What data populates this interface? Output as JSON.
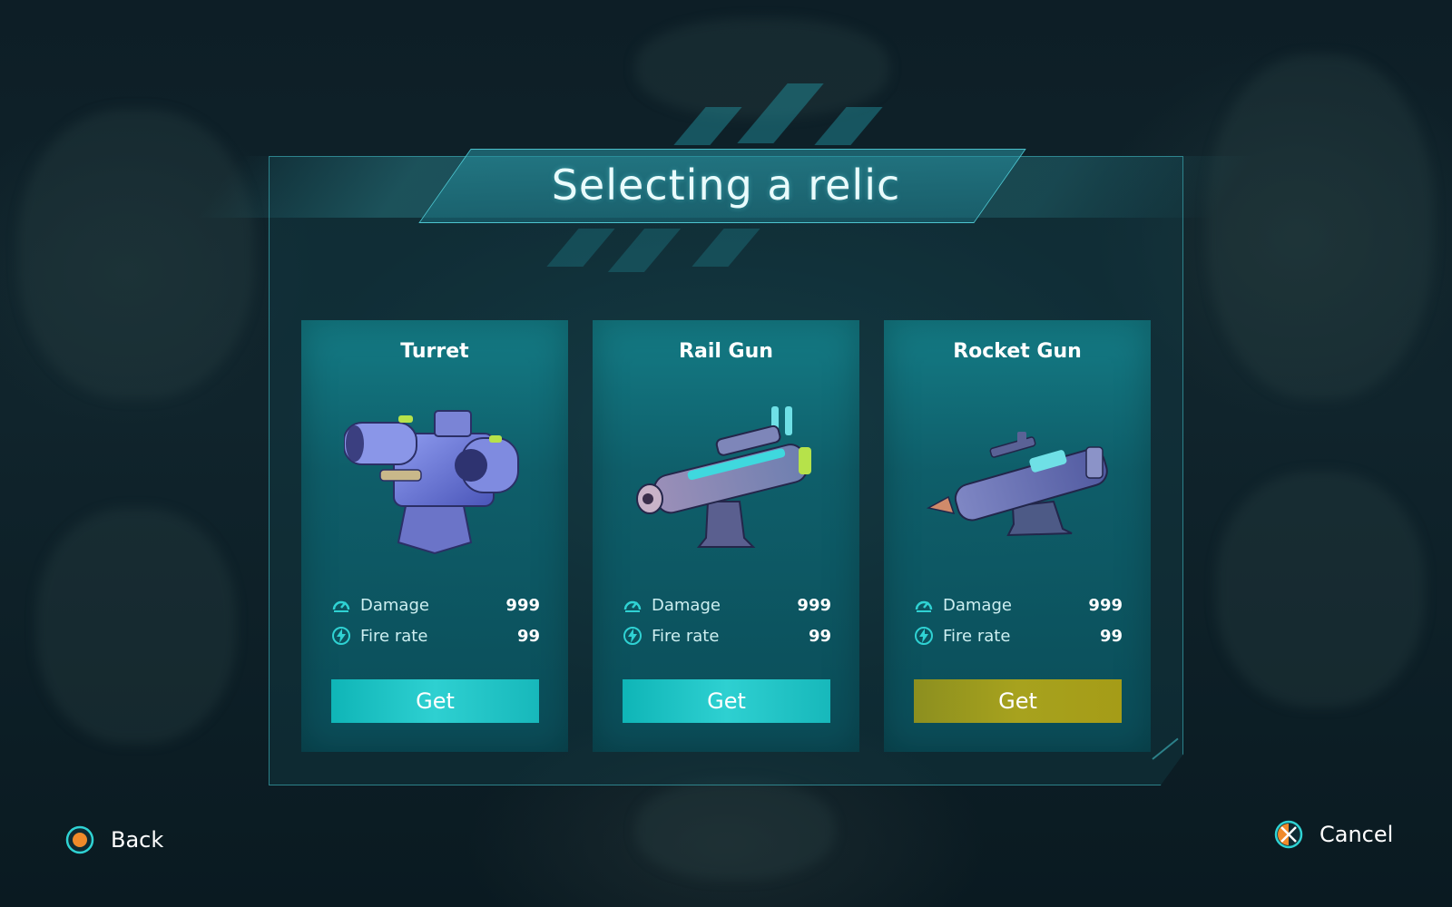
{
  "screen": {
    "title": "Selecting a relic"
  },
  "relics": [
    {
      "name": "Turret",
      "weapon_icon": "turret-icon",
      "stats": [
        {
          "label": "Damage",
          "value": "999",
          "icon": "speedometer-icon"
        },
        {
          "label": "Fire rate",
          "value": "99",
          "icon": "lightning-icon"
        }
      ],
      "button_label": "Get",
      "button_color": "#1fc3c4"
    },
    {
      "name": "Rail Gun",
      "weapon_icon": "rail-gun-icon",
      "stats": [
        {
          "label": "Damage",
          "value": "999",
          "icon": "speedometer-icon"
        },
        {
          "label": "Fire rate",
          "value": "99",
          "icon": "lightning-icon"
        }
      ],
      "button_label": "Get",
      "button_color": "#1fc3c4"
    },
    {
      "name": "Rocket Gun",
      "weapon_icon": "rocket-gun-icon",
      "stats": [
        {
          "label": "Damage",
          "value": "999",
          "icon": "speedometer-icon"
        },
        {
          "label": "Fire rate",
          "value": "99",
          "icon": "lightning-icon"
        }
      ],
      "button_label": "Get",
      "button_color": "#a39d1c"
    }
  ],
  "controls": {
    "back": {
      "label": "Back",
      "icon": "circle-button-icon"
    },
    "cancel": {
      "label": "Cancel",
      "icon": "cross-button-icon"
    }
  },
  "colors": {
    "accent": "#2fd2d3",
    "highlight_button": "#a39d1c",
    "controller_orange": "#f08a2a"
  }
}
